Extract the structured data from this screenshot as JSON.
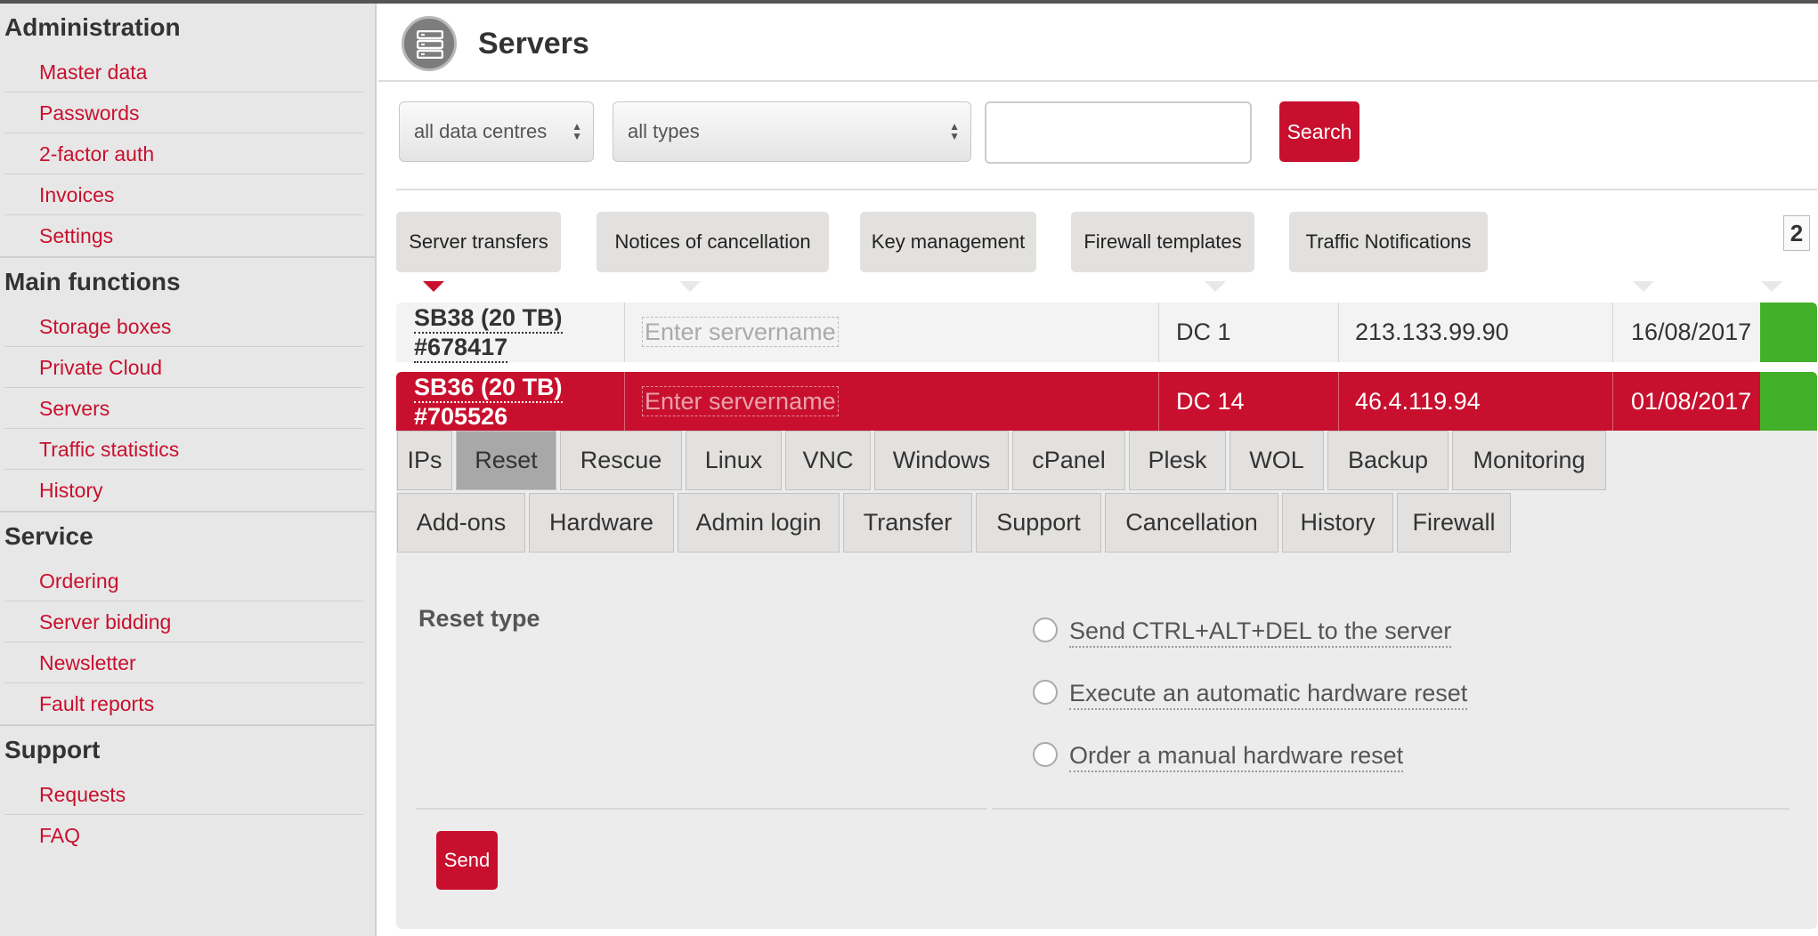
{
  "sidebar": {
    "sections": [
      {
        "title": "Administration",
        "items": [
          "Master data",
          "Passwords",
          "2-factor auth",
          "Invoices",
          "Settings"
        ]
      },
      {
        "title": "Main functions",
        "items": [
          "Storage boxes",
          "Private Cloud",
          "Servers",
          "Traffic statistics",
          "History"
        ]
      },
      {
        "title": "Service",
        "items": [
          "Ordering",
          "Server bidding",
          "Newsletter",
          "Fault reports"
        ]
      },
      {
        "title": "Support",
        "items": [
          "Requests",
          "FAQ"
        ]
      }
    ]
  },
  "header": {
    "title": "Servers",
    "icon": "server-stack-icon"
  },
  "filters": {
    "datacentre_value": "all data centres",
    "type_value": "all types",
    "search_value": "",
    "search_button": "Search"
  },
  "quick_tabs": [
    "Server transfers",
    "Notices of cancellation",
    "Key management",
    "Firewall templates",
    "Traffic Notifications"
  ],
  "pagination": {
    "page": "2"
  },
  "servers": [
    {
      "name_line1": "SB38 (20 TB)",
      "name_line2": "#678417",
      "servername_placeholder": "Enter servername",
      "dc": "DC 1",
      "ip": "213.133.99.90",
      "date": "16/08/2017",
      "status_color": "#43b02a"
    },
    {
      "name_line1": "SB36 (20 TB)",
      "name_line2": "#705526",
      "servername_placeholder": "Enter servername",
      "dc": "DC 14",
      "ip": "46.4.119.94",
      "date": "01/08/2017",
      "status_color": "#43b02a"
    }
  ],
  "action_tabs_row1": [
    "IPs",
    "Reset",
    "Rescue",
    "Linux",
    "VNC",
    "Windows",
    "cPanel",
    "Plesk",
    "WOL",
    "Backup",
    "Monitoring"
  ],
  "action_tabs_row2": [
    "Add-ons",
    "Hardware",
    "Admin login",
    "Transfer",
    "Support",
    "Cancellation",
    "History",
    "Firewall"
  ],
  "active_action_tab": "Reset",
  "reset": {
    "type_label": "Reset type",
    "options": [
      "Send CTRL+ALT+DEL to the server",
      "Execute an automatic hardware reset",
      "Order a manual hardware reset"
    ],
    "send_button": "Send"
  },
  "colors": {
    "accent": "#c8102e",
    "status_ok": "#43b02a",
    "sidebar_bg": "#e7e7e7"
  }
}
